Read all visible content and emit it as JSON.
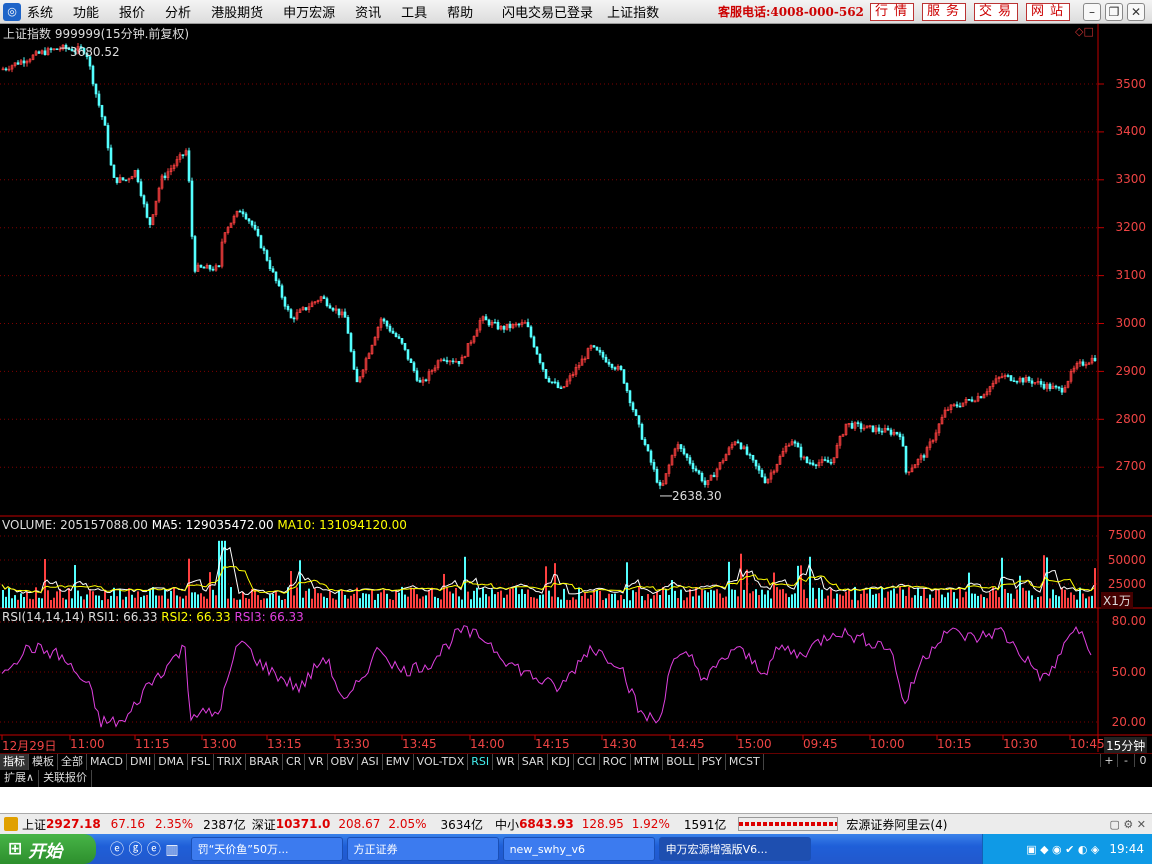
{
  "menu": {
    "items": [
      "系统",
      "功能",
      "报价",
      "分析",
      "港股期货",
      "申万宏源",
      "资讯",
      "工具",
      "帮助"
    ],
    "center_text": [
      "闪电交易已登录",
      "上证指数"
    ],
    "phone": "客服电话:4008-000-562",
    "right_buttons": [
      "行情",
      "服务",
      "交易",
      "网站"
    ],
    "window_buttons": [
      "minimize",
      "restore",
      "close"
    ]
  },
  "main_chart": {
    "title": "上证指数 999999(15分钟.前复权)",
    "high_label": "3680.52",
    "low_label": "2638.30",
    "y_ticks": [
      "3500",
      "3400",
      "3300",
      "3200",
      "3100",
      "3000",
      "2900",
      "2800",
      "2700"
    ]
  },
  "volume_panel": {
    "label": "VOLUME: 205157088.00",
    "ma5": "MA5: 129035472.00",
    "ma10": "MA10: 131094120.00",
    "y_ticks": [
      "75000",
      "50000",
      "25000"
    ],
    "unit": "X1万"
  },
  "rsi_panel": {
    "label": "RSI(14,14,14)",
    "rsi1": "RSI1: 66.33",
    "rsi2": "RSI2: 66.33",
    "rsi3": "RSI3: 66.33",
    "y_ticks": [
      "80.00",
      "50.00",
      "20.00"
    ]
  },
  "time_axis": {
    "labels": [
      "12月29日",
      "11:00",
      "11:15",
      "13:00",
      "13:15",
      "13:30",
      "13:45",
      "14:00",
      "14:15",
      "14:30",
      "14:45",
      "15:00",
      "09:45",
      "10:00",
      "10:15",
      "10:30",
      "10:45"
    ],
    "period": "15分钟"
  },
  "indicator_tabs": [
    "指标",
    "模板",
    "全部",
    "MACD",
    "DMI",
    "DMA",
    "FSL",
    "TRIX",
    "BRAR",
    "CR",
    "VR",
    "OBV",
    "ASI",
    "EMV",
    "VOL-TDX",
    "RSI",
    "WR",
    "SAR",
    "KDJ",
    "CCI",
    "ROC",
    "MTM",
    "BOLL",
    "PSY",
    "MCST"
  ],
  "indicator_active": "RSI",
  "tab_controls": [
    "+",
    "-",
    "0"
  ],
  "sub_tabs": [
    "扩展∧",
    "关联报价"
  ],
  "status_bar": {
    "sh_name": "上证",
    "sh_value": "2927.18",
    "sh_change": "67.16",
    "sh_pct": "2.35%",
    "sh_amount": "2387亿",
    "sz_name": "深证",
    "sz_value": "10371.0",
    "sz_change": "208.67",
    "sz_pct": "2.05%",
    "sz_amount": "3634亿",
    "zx_name": "中小",
    "zx_value": "6843.93",
    "zx_change": "128.95",
    "zx_pct": "1.92%",
    "zx_amount": "1591亿",
    "broker": "宏源证券阿里云(4)"
  },
  "taskbar": {
    "start": "开始",
    "tasks": [
      "罚“天价鱼”50万...",
      "方正证券",
      "new_swhy_v6",
      "申万宏源增强版V6..."
    ],
    "clock": "19:44"
  },
  "colors": {
    "up": "#ff4040",
    "down": "#54ffff",
    "axis": "#c00000",
    "ma5": "#ffffff",
    "ma10": "#ffff00",
    "rsi": "#e040e0"
  }
}
